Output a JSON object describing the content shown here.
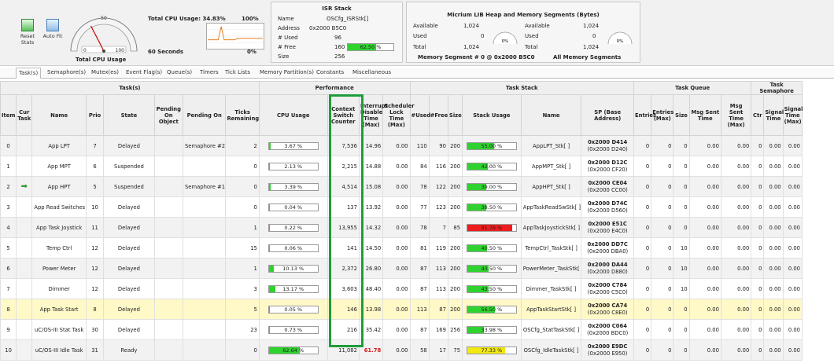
{
  "toolbar": {
    "reset_label": "Reset Stats",
    "autofit_label": "Auto Fit"
  },
  "gauge": {
    "label": "Total CPU Usage",
    "min": "0",
    "mid": "50",
    "max": "100",
    "value": 34.83
  },
  "cpu_usage": {
    "title": "Total CPU Usage: 34.83%",
    "pct_max": "100%",
    "seconds": "60 Seconds",
    "pct_min": "0%"
  },
  "isr": {
    "title": "ISR Stack",
    "name_k": "Name",
    "name_v": "OSCfg_ISRStk[]",
    "addr_k": "Address",
    "addr_v": "0x2000 B5C0",
    "used_k": "# Used",
    "used_v": "96",
    "free_k": "# Free",
    "free_v": "160",
    "free_pct": "62.50 %",
    "free_frac": 0.625,
    "size_k": "Size",
    "size_v": "256"
  },
  "heap": {
    "title": "Micrium LIB Heap and Memory Segments (Bytes)",
    "avail_k": "Available",
    "avail_v": "1,024",
    "used_k": "Used",
    "used_v": "0",
    "total_k": "Total",
    "total_v": "1,024",
    "pct": "0%",
    "seg_label": "Memory Segment # 0 @ 0x2000 B5C0",
    "all_label": "All Memory Segments",
    "avail2_v": "1,024",
    "used2_v": "0",
    "total2_v": "1,024",
    "pct2": "0%"
  },
  "tabs": [
    "Task(s)",
    "Semaphore(s)",
    "Mutex(es)",
    "Event Flag(s)",
    "Queue(s)",
    "Timers",
    "Tick Lists",
    "Memory Partition(s)",
    "Constants",
    "Miscellaneous"
  ],
  "groups": {
    "tasks": "Task(s)",
    "perf": "Performance",
    "stack": "Task Stack",
    "queue": "Task Queue",
    "sem": "Task Semaphore"
  },
  "headers": [
    "Item",
    "Cur Task",
    "Name",
    "Prio",
    "State",
    "Pending On Object",
    "Pending On",
    "Ticks Remaining",
    "CPU Usage",
    "Context Switch Counter",
    "Interrupt Disable Time (Max)",
    "Scheduler Lock Time (Max)",
    "#Used",
    "#Free",
    "Size",
    "Stack Usage",
    "Name",
    "SP (Base Address)",
    "Entries",
    "Entries (Max)",
    "Size",
    "Msg Sent Time",
    "Msg Sent Time (Max)",
    "Ctr",
    "Signal Time",
    "Signal Time (Max)"
  ],
  "rows": [
    {
      "item": "0",
      "cur": "",
      "name": "App LPT",
      "prio": "7",
      "state": "Delayed",
      "pobj": "",
      "pon": "Semaphore #2",
      "ticks": "2",
      "cpu": "3.67 %",
      "cpu_f": 0.0367,
      "ctx": "7,536",
      "irq": "14.96",
      "irq_red": false,
      "sch": "0.00",
      "used": "110",
      "free": "90",
      "size": "200",
      "stk": "55.00 %",
      "stk_f": 0.55,
      "stk_c": "#2fd32f",
      "sname": "AppLPT_Stk[ ]",
      "sp1": "0x2000 D414",
      "sp2": "(0x2000 D240)",
      "qe": "0",
      "qem": "0",
      "qs": "0",
      "qt": "0.00",
      "qtm": "0.00",
      "ctr": "0",
      "st": "0.00",
      "stm": "0.00",
      "hl": false
    },
    {
      "item": "1",
      "cur": "",
      "name": "App MPT",
      "prio": "6",
      "state": "Suspended",
      "pobj": "",
      "pon": "",
      "ticks": "0",
      "cpu": "2.13 %",
      "cpu_f": 0.0213,
      "ctx": "2,215",
      "irq": "14.88",
      "irq_red": false,
      "sch": "0.00",
      "used": "84",
      "free": "116",
      "size": "200",
      "stk": "42.00 %",
      "stk_f": 0.42,
      "stk_c": "#2fd32f",
      "sname": "AppMPT_Stk[ ]",
      "sp1": "0x2000 D12C",
      "sp2": "(0x2000 CF20)",
      "qe": "0",
      "qem": "0",
      "qs": "0",
      "qt": "0.00",
      "qtm": "0.00",
      "ctr": "0",
      "st": "0.00",
      "stm": "0.00",
      "hl": false
    },
    {
      "item": "2",
      "cur": "➡",
      "name": "App HPT",
      "prio": "5",
      "state": "Suspended",
      "pobj": "",
      "pon": "Semaphore #1",
      "ticks": "0",
      "cpu": "3.39 %",
      "cpu_f": 0.0339,
      "ctx": "4,514",
      "irq": "15.08",
      "irq_red": false,
      "sch": "0.00",
      "used": "78",
      "free": "122",
      "size": "200",
      "stk": "39.00 %",
      "stk_f": 0.39,
      "stk_c": "#2fd32f",
      "sname": "AppHPT_Stk[ ]",
      "sp1": "0x2000 CE04",
      "sp2": "(0x2000 CC00)",
      "qe": "0",
      "qem": "0",
      "qs": "0",
      "qt": "0.00",
      "qtm": "0.00",
      "ctr": "0",
      "st": "0.00",
      "stm": "0.00",
      "hl": false
    },
    {
      "item": "3",
      "cur": "",
      "name": "App Read Switches",
      "prio": "10",
      "state": "Delayed",
      "pobj": "",
      "pon": "",
      "ticks": "0",
      "cpu": "0.04 %",
      "cpu_f": 0.0004,
      "ctx": "137",
      "irq": "13.92",
      "irq_red": false,
      "sch": "0.00",
      "used": "77",
      "free": "123",
      "size": "200",
      "stk": "38.50 %",
      "stk_f": 0.385,
      "stk_c": "#2fd32f",
      "sname": "AppTaskReadSwStk[ ]",
      "sp1": "0x2000 D74C",
      "sp2": "(0x2000 D560)",
      "qe": "0",
      "qem": "0",
      "qs": "0",
      "qt": "0.00",
      "qtm": "0.00",
      "ctr": "0",
      "st": "0.00",
      "stm": "0.00",
      "hl": false
    },
    {
      "item": "4",
      "cur": "",
      "name": "App Task Joystick",
      "prio": "11",
      "state": "Delayed",
      "pobj": "",
      "pon": "",
      "ticks": "1",
      "cpu": "0.22 %",
      "cpu_f": 0.0022,
      "ctx": "13,955",
      "irq": "14.32",
      "irq_red": false,
      "sch": "0.00",
      "used": "78",
      "free": "7",
      "size": "85",
      "stk": "91.76 %",
      "stk_f": 0.9176,
      "stk_c": "#ee1c1c",
      "sname": "AppTaskJoystickStk[ ]",
      "sp1": "0x2000 E51C",
      "sp2": "(0x2000 E4C0)",
      "qe": "0",
      "qem": "0",
      "qs": "0",
      "qt": "0.00",
      "qtm": "0.00",
      "ctr": "0",
      "st": "0.00",
      "stm": "0.00",
      "hl": false
    },
    {
      "item": "5",
      "cur": "",
      "name": "Temp Ctrl",
      "prio": "12",
      "state": "Delayed",
      "pobj": "",
      "pon": "",
      "ticks": "15",
      "cpu": "0.06 %",
      "cpu_f": 0.0006,
      "ctx": "141",
      "irq": "14.50",
      "irq_red": false,
      "sch": "0.00",
      "used": "81",
      "free": "119",
      "size": "200",
      "stk": "40.50 %",
      "stk_f": 0.405,
      "stk_c": "#2fd32f",
      "sname": "TempCtrl_TaskStk[ ]",
      "sp1": "0x2000 DD7C",
      "sp2": "(0x2000 DBA0)",
      "qe": "0",
      "qem": "0",
      "qs": "10",
      "qt": "0.00",
      "qtm": "0.00",
      "ctr": "0",
      "st": "0.00",
      "stm": "0.00",
      "hl": false
    },
    {
      "item": "6",
      "cur": "",
      "name": "Power Meter",
      "prio": "12",
      "state": "Delayed",
      "pobj": "",
      "pon": "",
      "ticks": "1",
      "cpu": "10.13 %",
      "cpu_f": 0.1013,
      "ctx": "2,372",
      "irq": "26.80",
      "irq_red": false,
      "sch": "0.00",
      "used": "87",
      "free": "113",
      "size": "200",
      "stk": "43.50 %",
      "stk_f": 0.435,
      "stk_c": "#2fd32f",
      "sname": "PowerMeter_TaskStk[ ]",
      "sp1": "0x2000 DA44",
      "sp2": "(0x2000 D880)",
      "qe": "0",
      "qem": "0",
      "qs": "10",
      "qt": "0.00",
      "qtm": "0.00",
      "ctr": "0",
      "st": "0.00",
      "stm": "0.00",
      "hl": false
    },
    {
      "item": "7",
      "cur": "",
      "name": "Dimmer",
      "prio": "12",
      "state": "Delayed",
      "pobj": "",
      "pon": "",
      "ticks": "3",
      "cpu": "13.17 %",
      "cpu_f": 0.1317,
      "ctx": "3,603",
      "irq": "48.40",
      "irq_red": false,
      "sch": "0.00",
      "used": "87",
      "free": "113",
      "size": "200",
      "stk": "43.50 %",
      "stk_f": 0.435,
      "stk_c": "#2fd32f",
      "sname": "Dimmer_TaskStk[ ]",
      "sp1": "0x2000 C784",
      "sp2": "(0x2000 C5C0)",
      "qe": "0",
      "qem": "0",
      "qs": "10",
      "qt": "0.00",
      "qtm": "0.00",
      "ctr": "0",
      "st": "0.00",
      "stm": "0.00",
      "hl": false
    },
    {
      "item": "8",
      "cur": "",
      "name": "App Task Start",
      "prio": "8",
      "state": "Delayed",
      "pobj": "",
      "pon": "",
      "ticks": "5",
      "cpu": "0.05 %",
      "cpu_f": 0.0005,
      "ctx": "146",
      "irq": "13.98",
      "irq_red": false,
      "sch": "0.00",
      "used": "113",
      "free": "87",
      "size": "200",
      "stk": "56.50 %",
      "stk_f": 0.565,
      "stk_c": "#2fd32f",
      "sname": "AppTaskStartStk[ ]",
      "sp1": "0x2000 CA74",
      "sp2": "(0x2000 C8E0)",
      "qe": "0",
      "qem": "0",
      "qs": "0",
      "qt": "0.00",
      "qtm": "0.00",
      "ctr": "0",
      "st": "0.00",
      "stm": "0.00",
      "hl": true
    },
    {
      "item": "9",
      "cur": "",
      "name": "uC/OS-III Stat Task",
      "prio": "30",
      "state": "Delayed",
      "pobj": "",
      "pon": "",
      "ticks": "23",
      "cpu": "0.73 %",
      "cpu_f": 0.0073,
      "ctx": "216",
      "irq": "35.42",
      "irq_red": false,
      "sch": "0.00",
      "used": "87",
      "free": "169",
      "size": "256",
      "stk": "33.98 %",
      "stk_f": 0.3398,
      "stk_c": "#2fd32f",
      "sname": "OSCfg_StatTaskStk[ ]",
      "sp1": "0x2000 C064",
      "sp2": "(0x2000 BDC0)",
      "qe": "0",
      "qem": "0",
      "qs": "0",
      "qt": "0.00",
      "qtm": "0.00",
      "ctr": "0",
      "st": "0.00",
      "stm": "0.00",
      "hl": false
    },
    {
      "item": "10",
      "cur": "",
      "name": "uC/OS-III Idle Task",
      "prio": "31",
      "state": "Ready",
      "pobj": "",
      "pon": "",
      "ticks": "0",
      "cpu": "62.64 %",
      "cpu_f": 0.6264,
      "ctx": "11,082",
      "irq": "61.78",
      "irq_red": true,
      "sch": "0.00",
      "used": "58",
      "free": "17",
      "size": "75",
      "stk": "77.33 %",
      "stk_f": 0.7733,
      "stk_c": "#f2e812",
      "sname": "OSCfg_IdleTaskStk[ ]",
      "sp1": "0x2000 E9DC",
      "sp2": "(0x2000 E950)",
      "qe": "0",
      "qem": "0",
      "qs": "0",
      "qt": "0.00",
      "qtm": "0.00",
      "ctr": "0",
      "st": "0.00",
      "stm": "0.00",
      "hl": false
    }
  ]
}
